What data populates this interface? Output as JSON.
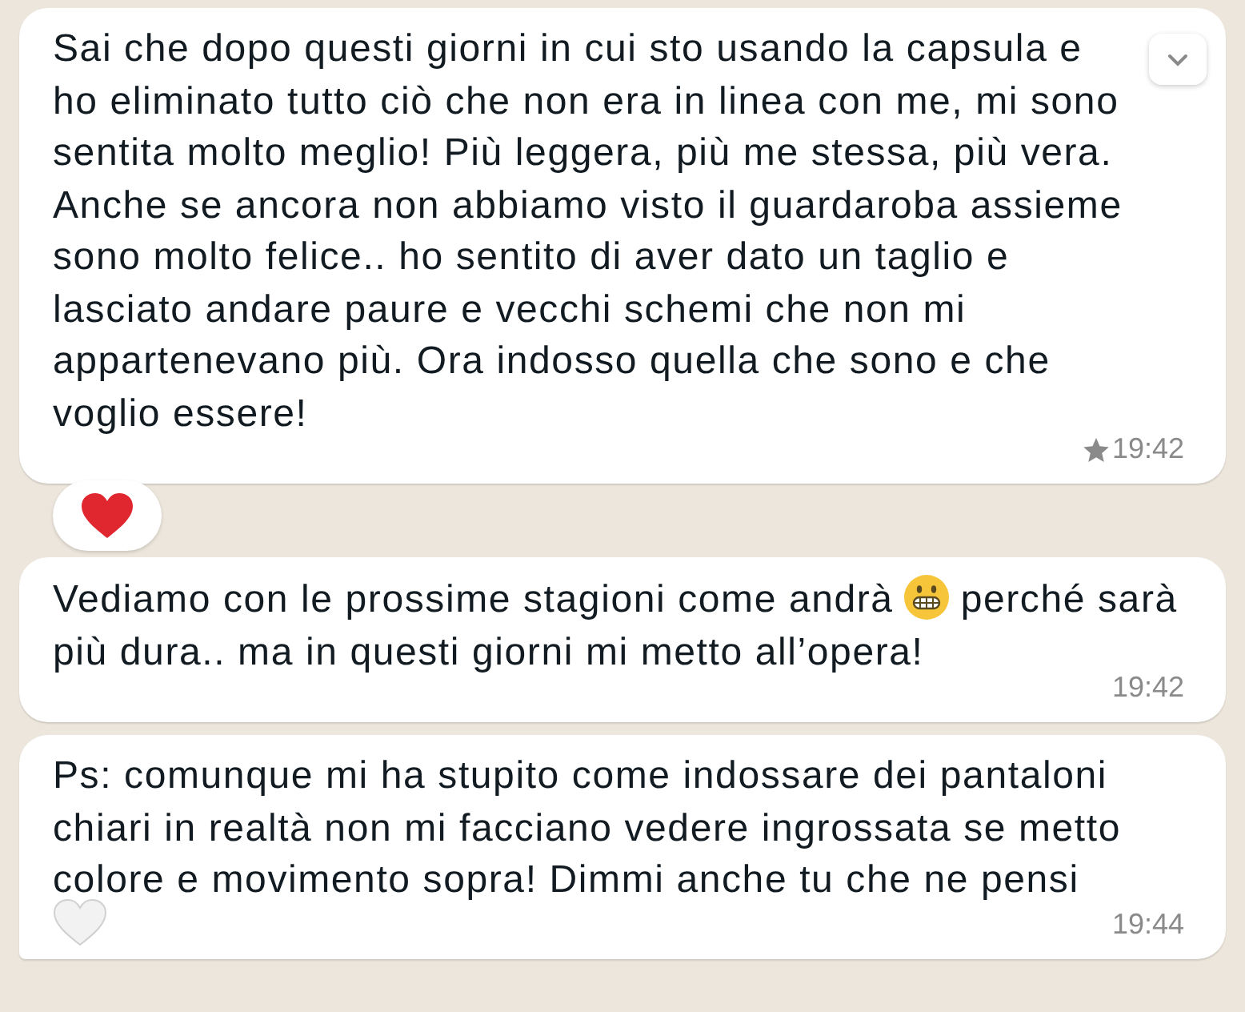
{
  "messages": [
    {
      "segments": [
        {
          "kind": "text",
          "text": "Sai che dopo questi giorni in cui sto usando la capsula e ho eliminato tutto ciò che non era in linea con me, mi sono sentita molto meglio! Più leggera, più me stessa, più vera. Anche se ancora non abbiamo visto il guardaroba assieme sono molto felice.. ho sentito di aver dato un taglio e lasciato andare paure e vecchi schemi che non mi appartenevano più. Ora indosso quella che sono e che voglio essere!"
        }
      ],
      "time": "19:42",
      "starred": true,
      "menu": true,
      "reacted": true,
      "tail": false
    },
    {
      "segments": [
        {
          "kind": "text",
          "text": "Vediamo con le prossime stagioni come andrà"
        },
        {
          "kind": "grimace-emoji"
        },
        {
          "kind": "text",
          "text": "perché sarà più dura.. ma in questi giorni mi metto all’opera!"
        }
      ],
      "time": "19:42",
      "starred": false,
      "menu": false,
      "reacted": false,
      "tail": false
    },
    {
      "segments": [
        {
          "kind": "text",
          "text": "Ps: comunque mi ha stupito come indossare dei pantaloni chiari in realtà non mi facciano vedere ingrossata se metto colore e movimento sopra! Dimmi anche tu che ne pensi"
        },
        {
          "kind": "white-heart-emoji"
        }
      ],
      "time": "19:44",
      "starred": false,
      "menu": false,
      "reacted": false,
      "tail": true
    }
  ]
}
